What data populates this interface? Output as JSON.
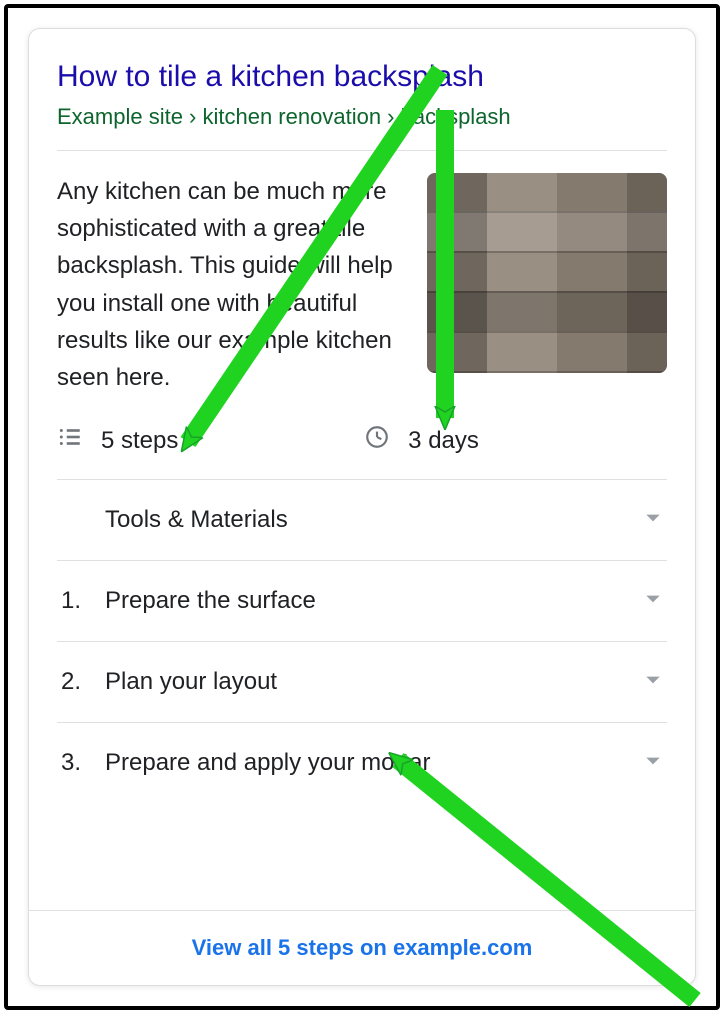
{
  "result": {
    "title": "How to tile a kitchen backsplash",
    "breadcrumb": "Example site › kitchen renovation › backsplash",
    "description": "Any kitchen can be much more sophisticated with a great tile backsplash. This guide will help you install one with beautiful results like our example kitchen seen here.",
    "meta": {
      "steps": "5 steps",
      "duration": "3 days"
    },
    "sections": [
      {
        "num": "",
        "label": "Tools & Materials"
      },
      {
        "num": "1.",
        "label": "Prepare the surface"
      },
      {
        "num": "2.",
        "label": "Plan your layout"
      },
      {
        "num": "3.",
        "label": "Prepare and apply your mortar"
      }
    ],
    "footer_link": "View all 5 steps on example.com"
  },
  "colors": {
    "arrow": "#2ecc40",
    "arrow_stroke": "#17a22c"
  }
}
